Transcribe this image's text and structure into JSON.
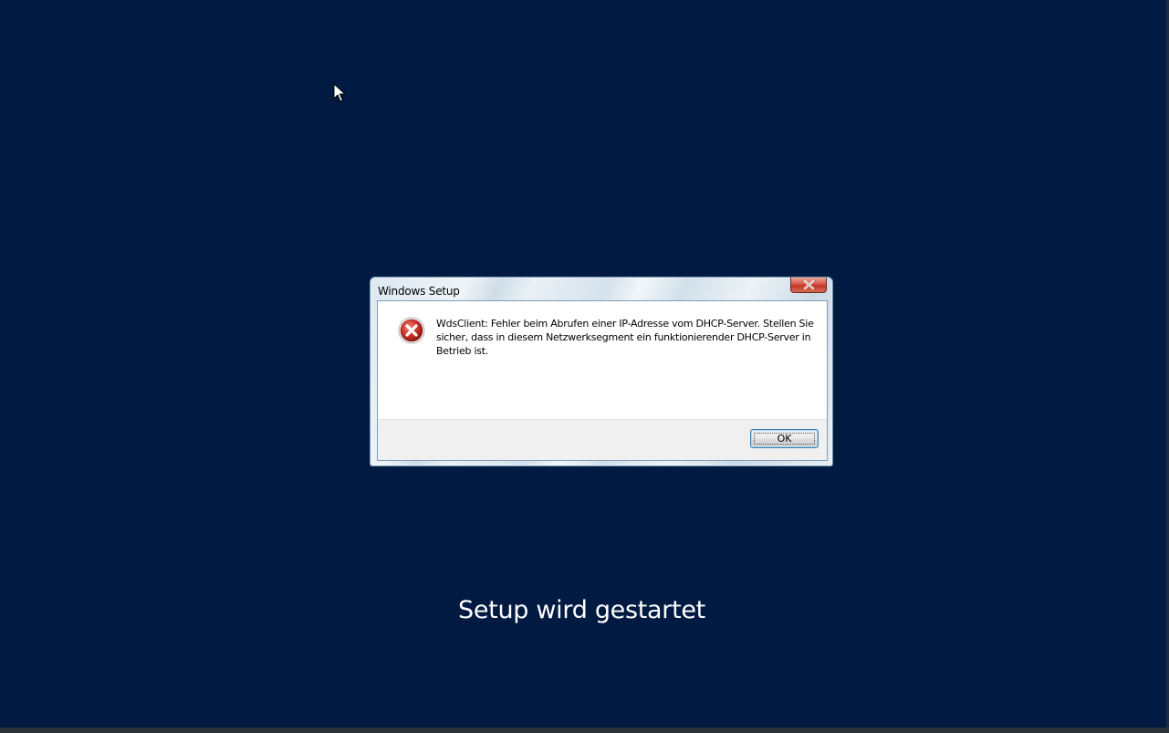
{
  "dialog": {
    "title": "Windows Setup",
    "message": "WdsClient: Fehler beim Abrufen einer IP-Adresse vom DHCP-Server. Stellen Sie sicher, dass in diesem Netzwerksegment ein funktionierender DHCP-Server in Betrieb ist.",
    "ok_label": "OK",
    "close_icon": "close-icon",
    "error_icon": "error-icon"
  },
  "status": {
    "text": "Setup wird gestartet"
  },
  "colors": {
    "background": "#011a42",
    "error_red": "#c0392b",
    "close_button": "#c0392b",
    "text_white": "#ffffff"
  }
}
